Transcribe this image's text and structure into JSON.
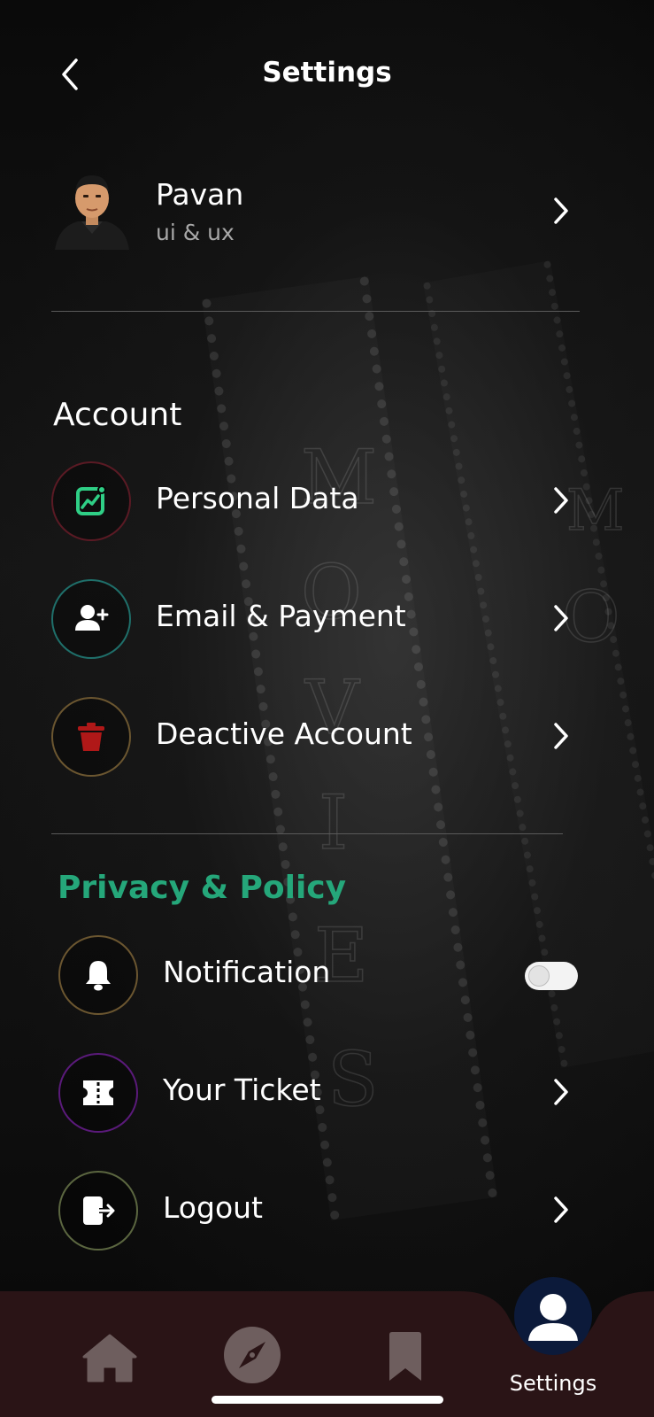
{
  "header": {
    "title": "Settings"
  },
  "profile": {
    "name": "Pavan",
    "role": "ui & ux"
  },
  "account": {
    "title": "Account",
    "items": [
      {
        "label": "Personal Data",
        "icon": "chart-icon",
        "ring_color": "#5a1a24",
        "icon_color": "#2fcf86"
      },
      {
        "label": "Email & Payment",
        "icon": "add-user-icon",
        "ring_color": "#1f6f6a",
        "icon_color": "#ffffff"
      },
      {
        "label": "Deactive Account",
        "icon": "trash-icon",
        "ring_color": "#6b5630",
        "icon_color": "#b01818"
      }
    ]
  },
  "privacy": {
    "title": "Privacy & Policy",
    "title_color": "#25a77a",
    "items": [
      {
        "label": "Notification",
        "icon": "bell-icon",
        "ring_color": "#6b5630",
        "control": "toggle",
        "toggle_on": false
      },
      {
        "label": "Your Ticket",
        "icon": "ticket-icon",
        "ring_color": "#5a1a7a",
        "control": "chevron"
      },
      {
        "label": "Logout",
        "icon": "logout-icon",
        "ring_color": "#5b6640",
        "control": "chevron"
      }
    ]
  },
  "tabbar": {
    "background": "#2a1416",
    "active_circle": "#0c1a3a",
    "tabs": [
      {
        "name": "home",
        "icon": "home-icon"
      },
      {
        "name": "explore",
        "icon": "compass-icon"
      },
      {
        "name": "saved",
        "icon": "bookmark-icon"
      },
      {
        "name": "settings",
        "icon": "user-icon",
        "label": "Settings",
        "active": true
      }
    ]
  }
}
